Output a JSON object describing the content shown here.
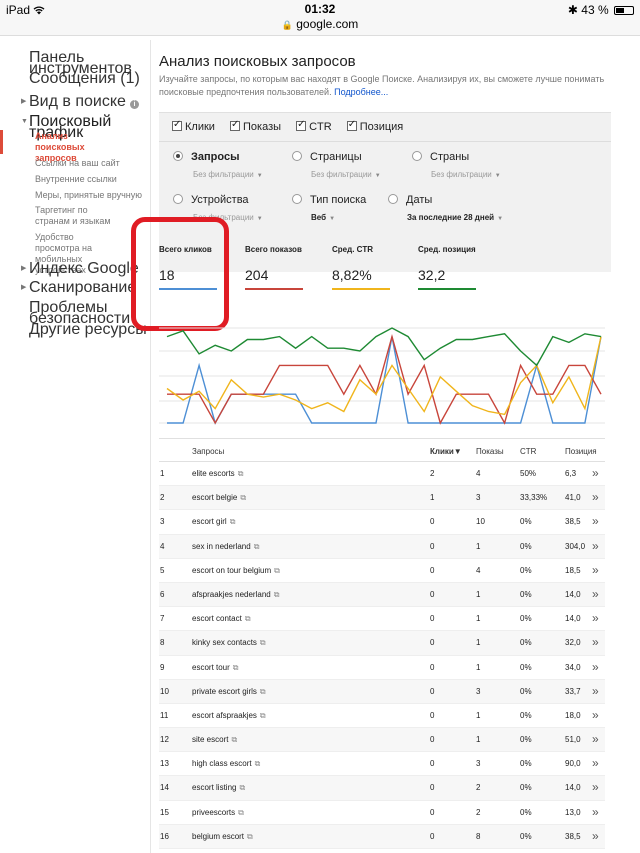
{
  "status_bar": {
    "device": "iPad",
    "wifi": "wifi-icon",
    "time": "01:32",
    "url": "google.com",
    "battery_percent": "43 %",
    "battery_level": 0.43
  },
  "sidebar": {
    "items": [
      {
        "label": "Панель инструментов"
      },
      {
        "label": "Сообщения (1)"
      },
      {
        "label": "Вид в поиске"
      },
      {
        "label": "Поисковый трафик"
      },
      {
        "label": "Анализ поисковых запросов"
      },
      {
        "label": "Ссылки на ваш сайт"
      },
      {
        "label": "Внутренние ссылки"
      },
      {
        "label": "Меры, принятые вручную"
      },
      {
        "label": "Таргетинг по странам и языкам"
      },
      {
        "label": "Удобство просмотра на мобильных устройствах"
      },
      {
        "label": "Индекс Google"
      },
      {
        "label": "Сканирование"
      },
      {
        "label": "Проблемы безопасности"
      },
      {
        "label": "Другие ресурсы"
      }
    ]
  },
  "main": {
    "title": "Анализ поисковых запросов",
    "description": "Изучайте запросы, по которым вас находят в Google Поиске. Анализируя их, вы сможете лучше понимать поисковые предпочтения пользователей.",
    "more_link": "Подробнее..."
  },
  "checkboxes": [
    "Клики",
    "Показы",
    "CTR",
    "Позиция"
  ],
  "dimensions": [
    {
      "label": "Запросы",
      "sub": "Без фильтрации"
    },
    {
      "label": "Страницы",
      "sub": "Без фильтрации"
    },
    {
      "label": "Страны",
      "sub": "Без фильтрации"
    },
    {
      "label": "Устройства",
      "sub": "Без фильтрации"
    },
    {
      "label": "Тип поиска",
      "sub": "Веб"
    },
    {
      "label": "Даты",
      "sub": "За последние 28 дней"
    }
  ],
  "metrics": [
    {
      "label": "Всего кликов",
      "value": "18",
      "color": "#4d8fd5"
    },
    {
      "label": "Всего показов",
      "value": "204",
      "color": "#c8453b"
    },
    {
      "label": "Сред. CTR",
      "value": "8,82%",
      "color": "#f0b51c"
    },
    {
      "label": "Сред. позиция",
      "value": "32,2",
      "color": "#1e8a33"
    }
  ],
  "chart_data": {
    "type": "line",
    "x": [
      1,
      2,
      3,
      4,
      5,
      6,
      7,
      8,
      9,
      10,
      11,
      12,
      13,
      14,
      15,
      16,
      17,
      18,
      19,
      20,
      21,
      22,
      23,
      24,
      25,
      26,
      27,
      28
    ],
    "series": [
      {
        "color": "#4d8fd5",
        "values": [
          0,
          0,
          2,
          0,
          1,
          1,
          1,
          1,
          1,
          0,
          0,
          0,
          0,
          0,
          3,
          0,
          0,
          0,
          0,
          0,
          0,
          0,
          0,
          2,
          0,
          0,
          0,
          3
        ]
      },
      {
        "color": "#c8453b",
        "values": [
          1,
          1,
          1,
          0,
          1,
          1,
          1,
          2,
          2,
          2,
          2,
          1,
          2,
          1,
          3,
          1,
          2,
          0,
          1,
          1,
          1,
          0,
          2,
          1,
          1,
          2,
          2,
          1
        ]
      },
      {
        "color": "#f0b51c",
        "values": [
          1.2,
          0.8,
          1.1,
          0.5,
          1.5,
          1.0,
          0.9,
          1.0,
          0.8,
          0.5,
          0.7,
          0.4,
          1.5,
          1.0,
          2.0,
          1.2,
          0.4,
          1.6,
          1.1,
          0.6,
          0.4,
          0.3,
          1.4,
          2.0,
          0.7,
          1.6,
          0.5,
          3.0
        ]
      },
      {
        "color": "#1e8a33",
        "values": [
          3.0,
          3.2,
          2.4,
          2.7,
          2.5,
          2.9,
          2.9,
          3.0,
          2.6,
          3.0,
          2.6,
          2.6,
          2.5,
          3.0,
          3.3,
          3.0,
          2.2,
          2.6,
          2.9,
          2.9,
          3.0,
          3.1,
          2.5,
          2.0,
          3.0,
          2.8,
          3.1,
          3.0
        ]
      }
    ]
  },
  "table": {
    "headers": {
      "queries": "Запросы",
      "clicks": "Клики▼",
      "impressions": "Показы",
      "ctr": "CTR",
      "position": "Позиция"
    },
    "rows": [
      {
        "n": "1",
        "q": "elite escorts",
        "clicks": "2",
        "impr": "4",
        "ctr": "50%",
        "pos": "6,3"
      },
      {
        "n": "2",
        "q": "escort belgie",
        "clicks": "1",
        "impr": "3",
        "ctr": "33,33%",
        "pos": "41,0"
      },
      {
        "n": "3",
        "q": "escort girl",
        "clicks": "0",
        "impr": "10",
        "ctr": "0%",
        "pos": "38,5"
      },
      {
        "n": "4",
        "q": "sex in nederland",
        "clicks": "0",
        "impr": "1",
        "ctr": "0%",
        "pos": "304,0"
      },
      {
        "n": "5",
        "q": "escort on tour belgium",
        "clicks": "0",
        "impr": "4",
        "ctr": "0%",
        "pos": "18,5"
      },
      {
        "n": "6",
        "q": "afspraakjes nederland",
        "clicks": "0",
        "impr": "1",
        "ctr": "0%",
        "pos": "14,0"
      },
      {
        "n": "7",
        "q": "escort contact",
        "clicks": "0",
        "impr": "1",
        "ctr": "0%",
        "pos": "14,0"
      },
      {
        "n": "8",
        "q": "kinky sex contacts",
        "clicks": "0",
        "impr": "1",
        "ctr": "0%",
        "pos": "32,0"
      },
      {
        "n": "9",
        "q": "escort tour",
        "clicks": "0",
        "impr": "1",
        "ctr": "0%",
        "pos": "34,0"
      },
      {
        "n": "10",
        "q": "private escort girls",
        "clicks": "0",
        "impr": "3",
        "ctr": "0%",
        "pos": "33,7"
      },
      {
        "n": "11",
        "q": "escort afspraakjes",
        "clicks": "0",
        "impr": "1",
        "ctr": "0%",
        "pos": "18,0"
      },
      {
        "n": "12",
        "q": "site escort",
        "clicks": "0",
        "impr": "1",
        "ctr": "0%",
        "pos": "51,0"
      },
      {
        "n": "13",
        "q": "high class escort",
        "clicks": "0",
        "impr": "3",
        "ctr": "0%",
        "pos": "90,0"
      },
      {
        "n": "14",
        "q": "escort listing",
        "clicks": "0",
        "impr": "2",
        "ctr": "0%",
        "pos": "14,0"
      },
      {
        "n": "15",
        "q": "priveescorts",
        "clicks": "0",
        "impr": "2",
        "ctr": "0%",
        "pos": "13,0"
      },
      {
        "n": "16",
        "q": "belgium escort",
        "clicks": "0",
        "impr": "8",
        "ctr": "0%",
        "pos": "38,5"
      }
    ]
  }
}
